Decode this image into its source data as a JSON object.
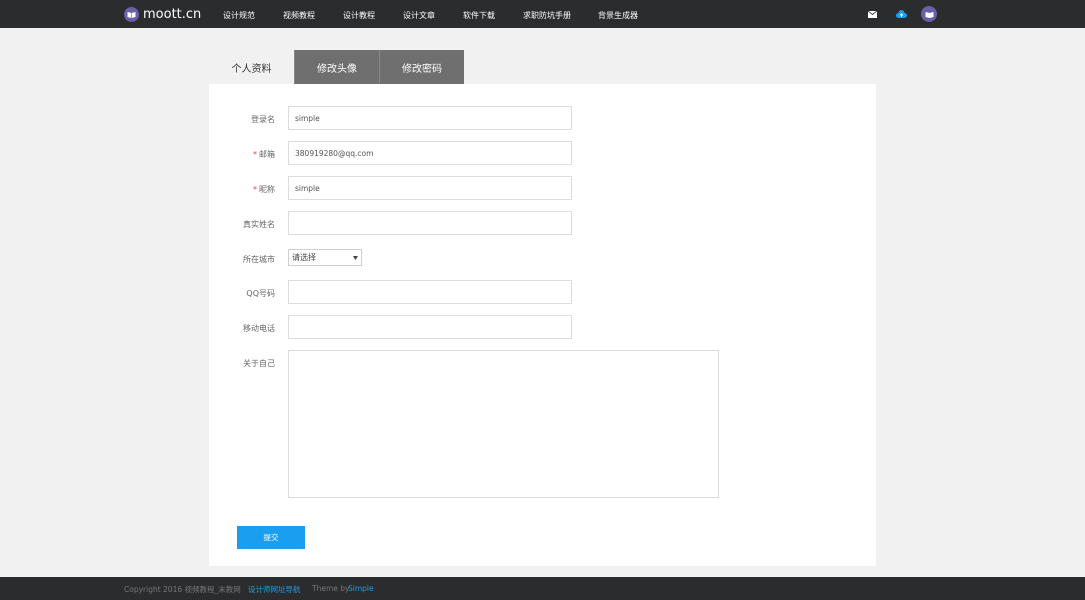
{
  "brand": {
    "name": "moott.cn",
    "color": "#6b5fa8"
  },
  "nav": {
    "items": [
      "设计规范",
      "视频教程",
      "设计教程",
      "设计文章",
      "软件下载",
      "求职防坑手册",
      "背景生成器"
    ],
    "icons": [
      "mail-icon",
      "cloud-upload-icon",
      "user-avatar"
    ]
  },
  "tabs": [
    {
      "label": "个人资料",
      "active": true
    },
    {
      "label": "修改头像",
      "active": false
    },
    {
      "label": "修改密码",
      "active": false
    }
  ],
  "form": {
    "login_label": "登录名",
    "login_value": "simple",
    "email_label": "邮箱",
    "email_value": "380919280@qq.com",
    "nickname_label": "昵称",
    "nickname_value": "simple",
    "realname_label": "真实姓名",
    "realname_value": "",
    "city_label": "所在城市",
    "city_value": "请选择",
    "qq_label": "QQ号码",
    "qq_value": "",
    "phone_label": "移动电话",
    "phone_value": "",
    "about_label": "关于自己",
    "about_value": "",
    "required_mark": "*",
    "submit_label": "提交"
  },
  "footer": {
    "copyright": "Copyright 2016 视频教程_末教网",
    "nav_link": "设计师网址导航",
    "theme_prefix": "Theme by",
    "theme_link": "Simple"
  },
  "colors": {
    "topbar": "#2b2c2d",
    "accent": "#1a9ff0",
    "required": "#e8472b"
  }
}
